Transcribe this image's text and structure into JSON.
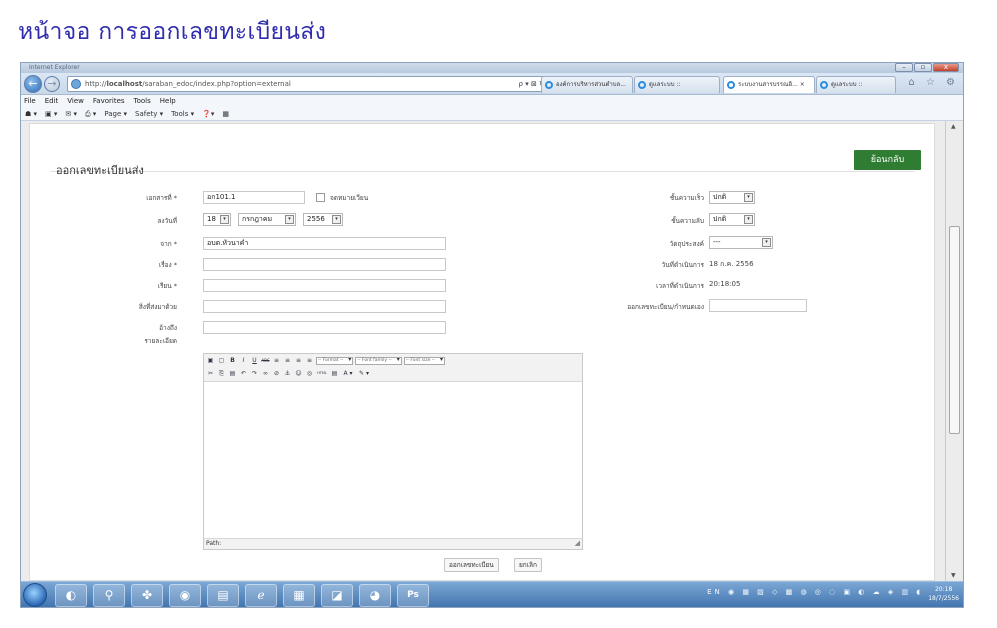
{
  "caption": "หน้าจอ การออกเลขทะเบียนส่ง",
  "browser": {
    "window_title": "Internet Explorer",
    "url_prefix": "http://",
    "url_host": "localhost",
    "url_path": "/saraban_edoc/index.php?option=external",
    "addr_tools": "ρ ▾ ⊠ ↻ ✕",
    "tabs": [
      {
        "label": "องค์การบริหารส่วนตำบล...",
        "active": false
      },
      {
        "label": "ดูแลระบบ ::",
        "active": false
      },
      {
        "label": "ระบบงานสารบรรณอิ... ×",
        "active": true
      },
      {
        "label": "ดูแลระบบ ::",
        "active": false
      }
    ],
    "nav_right_icons": "⌂ ☆ ⚙",
    "menu": [
      "File",
      "Edit",
      "View",
      "Favorites",
      "Tools",
      "Help"
    ],
    "command_bar": [
      "☗ ▾",
      "▣ ▾",
      "✉ ▾",
      "⎙ ▾",
      "Page ▾",
      "Safety ▾",
      "Tools ▾",
      "❓▾",
      "▦"
    ]
  },
  "form": {
    "title": "ออกเลขทะเบียนส่ง",
    "back_button": "ย้อนกลับ",
    "labels": {
      "doc_no": "เอกสารที่ *",
      "date": "ลงวันที่",
      "from": "จาก *",
      "subject": "เรื่อง *",
      "to": "เรียน *",
      "attach": "สิ่งที่ส่งมาด้วย",
      "ref": "อ้างถึง",
      "detail": "รายละเอียด",
      "secret": "ชั้นความลับ",
      "urgency": "ชั้นความเร็ว",
      "purpose": "วัตถุประสงค์",
      "op_date": "วันที่ดำเนินการ",
      "op_time": "เวลาที่ดำเนินการ",
      "custom_no": "ออกเลขทะเบียน/กำหนดเอง"
    },
    "values": {
      "doc_no": "อก101.1",
      "register_check": "จดหมายเวียน",
      "day": "18",
      "month": "กรกฎาคม",
      "year": "2556",
      "from": "อบต.หัวนาคำ",
      "subject": "",
      "to": "",
      "attach": "",
      "ref": "",
      "urgency": "ปกติ",
      "secret": "ปกติ",
      "purpose": "---",
      "op_date": "18 ก.ค. 2556",
      "op_time": "20:18:05",
      "custom_no": ""
    },
    "editor": {
      "format": "-- Format --",
      "font_family": "-- Font family --",
      "font_size": "-- Font size --",
      "path_label": "Path:",
      "row1": [
        "▣",
        "▢",
        "B",
        "I",
        "U",
        "ABC",
        "≡",
        "≡",
        "≡",
        "≡"
      ],
      "row2": [
        "✂",
        "⎘",
        "▤",
        "↶",
        "↷",
        "∞",
        "⊘",
        "⚓",
        "☺",
        "◎",
        "HTML",
        "▤",
        "A ▾",
        "✎ ▾"
      ]
    },
    "submit_button": "ออกเลขทะเบียน",
    "cancel_button": "ยกเลิก"
  },
  "taskbar": {
    "apps": [
      "◐",
      "⚲",
      "✤",
      "◉",
      "▤",
      "ℯ",
      "▦",
      "◪",
      "◕",
      "Ps"
    ],
    "tray_lang": "EN",
    "tray_icons": "◉ ▦ ▨ ◇ ▩ ◍ ◎ ◌ ▣ ◐ ☁ ◈ ▥ ◖",
    "clock_time": "20:18",
    "clock_date": "18/7/2556"
  }
}
